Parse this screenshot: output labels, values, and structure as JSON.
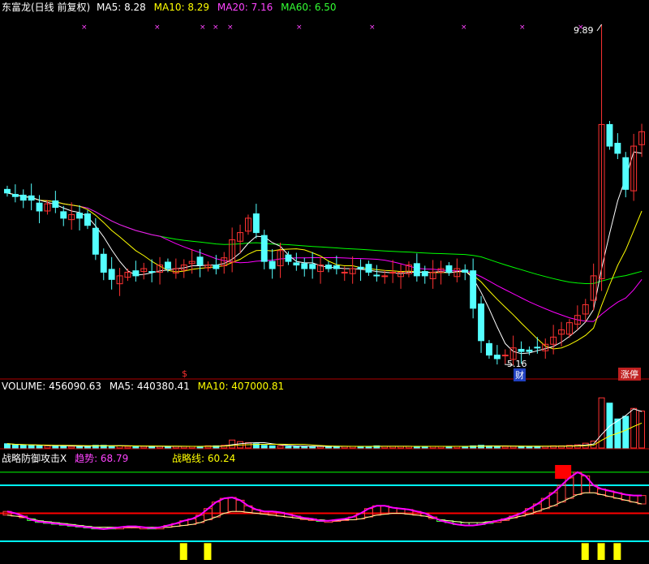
{
  "price_header": {
    "name": "东富龙(日线 前复权)",
    "ma5": "MA5: 8.28",
    "ma10": "MA10: 8.29",
    "ma20": "MA20: 7.16",
    "ma60": "MA60: 6.50"
  },
  "volume_header": {
    "volume": "VOLUME: 456090.63",
    "ma5": "MA5: 440380.41",
    "ma10": "MA10: 407000.81"
  },
  "indicator_header": {
    "name": "战略防御攻击X",
    "trend": "趋势: 68.79",
    "strategy": "战略线: 60.24"
  },
  "annotations": {
    "high_label": "9.89",
    "low_label": "5.16",
    "cai_badge": "财",
    "zhang_badge": "涨停",
    "dollar_mark": "$"
  },
  "colors": {
    "background": "#000000",
    "up": "#ff3232",
    "down": "#54ffff",
    "ma5": "#ffffff",
    "ma10": "#ffff00",
    "ma20": "#ff00ff",
    "ma60": "#00ff00",
    "level_cyan": "#00ffff",
    "level_red": "#ff0000",
    "level_green": "#00ff00"
  },
  "chart_data": [
    {
      "type": "candlestick",
      "panel": "price",
      "high": 9.89,
      "low": 5.16,
      "moving_averages": {
        "MA5": 8.28,
        "MA10": 8.29,
        "MA20": 7.16,
        "MA60": 6.5
      },
      "close": [
        7.55,
        7.5,
        7.45,
        7.45,
        7.3,
        7.4,
        7.35,
        7.2,
        7.25,
        7.2,
        7.1,
        6.7,
        6.45,
        6.35,
        6.4,
        6.45,
        6.4,
        6.5,
        6.45,
        6.55,
        6.5,
        6.5,
        6.55,
        6.6,
        6.55,
        6.55,
        6.5,
        6.65,
        6.9,
        7.0,
        7.2,
        7.0,
        6.6,
        6.5,
        6.75,
        6.6,
        6.55,
        6.5,
        6.5,
        6.55,
        6.5,
        6.5,
        6.45,
        6.5,
        6.5,
        6.45,
        6.4,
        6.4,
        6.45,
        6.45,
        6.55,
        6.4,
        6.4,
        6.45,
        6.5,
        6.45,
        6.5,
        6.45,
        5.95,
        5.5,
        5.3,
        5.25,
        5.3,
        5.4,
        5.35,
        5.35,
        5.4,
        5.45,
        5.55,
        5.65,
        5.75,
        5.85,
        6.0,
        6.4,
        8.5,
        8.2,
        8.1,
        7.6,
        8.2,
        8.4
      ]
    },
    {
      "type": "bar",
      "panel": "volume",
      "volume": 456090.63,
      "moving_averages": {
        "MA5": 440380.41,
        "MA10": 407000.81
      },
      "values": [
        0.08,
        0.06,
        0.05,
        0.05,
        0.04,
        0.04,
        0.04,
        0.04,
        0.03,
        0.03,
        0.04,
        0.05,
        0.05,
        0.04,
        0.04,
        0.03,
        0.03,
        0.03,
        0.03,
        0.03,
        0.03,
        0.03,
        0.03,
        0.03,
        0.03,
        0.04,
        0.04,
        0.05,
        0.15,
        0.12,
        0.1,
        0.08,
        0.05,
        0.04,
        0.04,
        0.03,
        0.03,
        0.03,
        0.03,
        0.03,
        0.03,
        0.03,
        0.03,
        0.03,
        0.03,
        0.03,
        0.04,
        0.03,
        0.03,
        0.03,
        0.03,
        0.03,
        0.03,
        0.03,
        0.03,
        0.03,
        0.03,
        0.03,
        0.04,
        0.05,
        0.04,
        0.03,
        0.03,
        0.03,
        0.03,
        0.03,
        0.03,
        0.03,
        0.04,
        0.04,
        0.05,
        0.06,
        0.09,
        0.13,
        0.95,
        0.85,
        0.55,
        0.6,
        0.75,
        0.7
      ]
    },
    {
      "type": "line",
      "panel": "indicator",
      "series": [
        {
          "name": "趋势",
          "last": 68.79,
          "values": [
            52,
            50,
            47,
            43,
            41,
            40,
            39,
            38,
            37,
            36,
            35,
            34,
            33,
            34,
            35,
            36,
            36,
            35,
            34,
            35,
            37,
            39,
            42,
            44,
            48,
            55,
            62,
            66,
            67,
            64,
            58,
            54,
            52,
            52,
            51,
            49,
            47,
            45,
            44,
            42,
            42,
            43,
            44,
            46,
            50,
            55,
            58,
            58,
            56,
            55,
            54,
            52,
            50,
            46,
            42,
            40,
            38,
            37,
            37,
            38,
            40,
            42,
            44,
            47,
            50,
            55,
            60,
            66,
            72,
            80,
            88,
            94,
            90,
            80,
            76,
            74,
            72,
            70,
            69,
            69
          ]
        },
        {
          "name": "战略线",
          "last": 60.24,
          "values": [
            48,
            47,
            46,
            44,
            42,
            41,
            40,
            39,
            38,
            37,
            36,
            35,
            35,
            35,
            35,
            35,
            35,
            35,
            35,
            35,
            35,
            36,
            37,
            38,
            40,
            43,
            46,
            50,
            52,
            52,
            51,
            50,
            49,
            48,
            47,
            46,
            45,
            44,
            43,
            43,
            42,
            42,
            43,
            43,
            44,
            46,
            48,
            49,
            50,
            50,
            49,
            48,
            47,
            45,
            43,
            42,
            41,
            40,
            40,
            40,
            41,
            42,
            43,
            45,
            47,
            49,
            52,
            55,
            58,
            62,
            66,
            70,
            72,
            72,
            70,
            68,
            66,
            64,
            62,
            60
          ]
        }
      ]
    }
  ]
}
